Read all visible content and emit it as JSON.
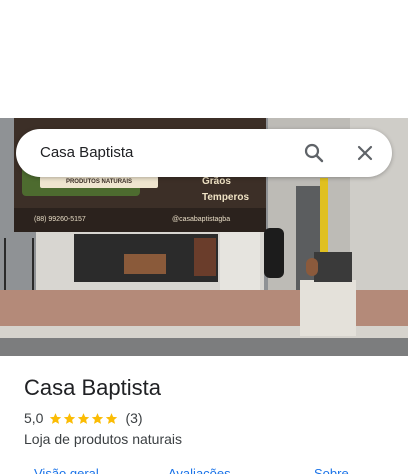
{
  "search": {
    "query": "Casa Baptista"
  },
  "photo": {
    "sign_brand": "PRODUTOS NATURAIS",
    "sign_words": [
      "Grãos",
      "Temperos"
    ],
    "sign_phone": "(88) 99260-5157",
    "sign_instagram": "@casabaptistagba"
  },
  "place": {
    "title": "Casa Baptista",
    "rating": "5,0",
    "stars": 5,
    "reviews": "(3)",
    "category": "Loja de produtos naturais"
  },
  "tabs": [
    {
      "label": "Visão geral"
    },
    {
      "label": "Avaliações"
    },
    {
      "label": "Sobre"
    }
  ],
  "colors": {
    "star": "#fbbc04",
    "accent": "#1a73e8",
    "text": "#202124",
    "secondary": "#3c4043"
  }
}
